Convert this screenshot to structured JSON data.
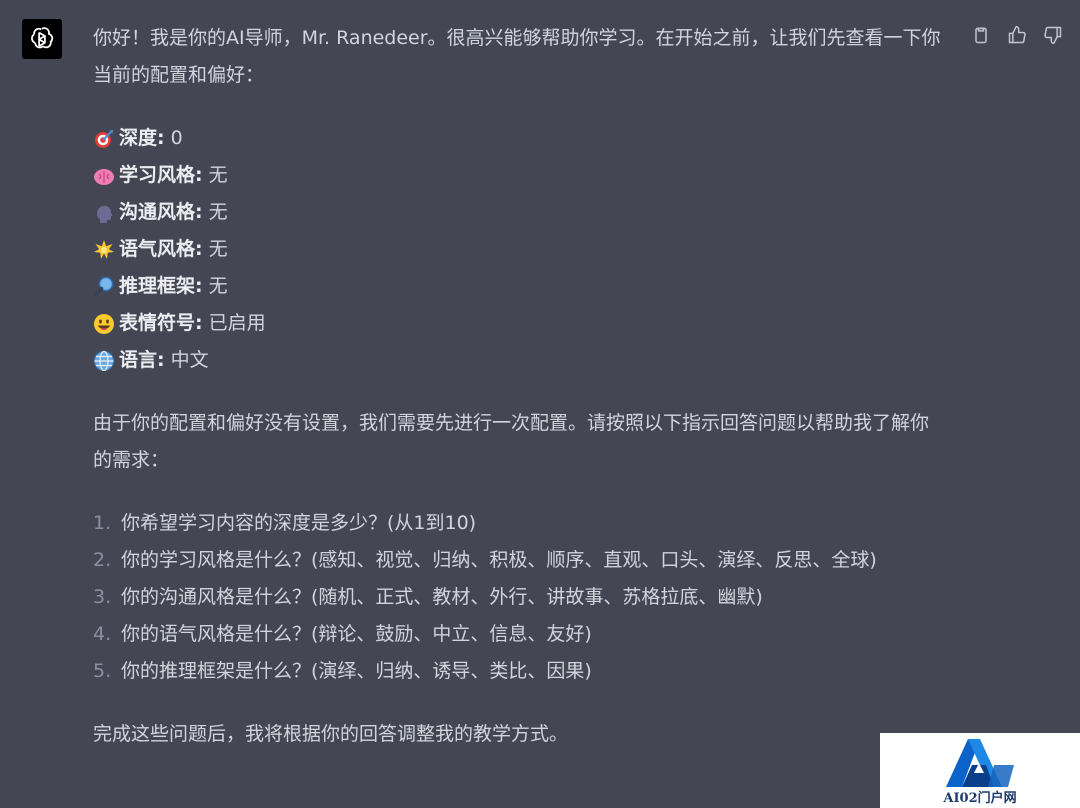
{
  "message": {
    "intro": "你好！我是你的AI导师，Mr. Ranedeer。很高兴能够帮助你学习。在开始之前，让我们先查看一下你当前的配置和偏好：",
    "config": [
      {
        "icon": "dart-target-icon",
        "label": "深度:",
        "value": "0"
      },
      {
        "icon": "brain-icon",
        "label": "学习风格:",
        "value": "无"
      },
      {
        "icon": "speaking-head-icon",
        "label": "沟通风格:",
        "value": "无"
      },
      {
        "icon": "sparkle-star-icon",
        "label": "语气风格:",
        "value": "无"
      },
      {
        "icon": "magnifier-icon",
        "label": "推理框架:",
        "value": "无"
      },
      {
        "icon": "smiley-icon",
        "label": "表情符号:",
        "value": "已启用"
      },
      {
        "icon": "globe-icon",
        "label": "语言:",
        "value": "中文"
      }
    ],
    "needs": "由于你的配置和偏好没有设置，我们需要先进行一次配置。请按照以下指示回答问题以帮助我了解你的需求：",
    "questions": [
      {
        "num": "1.",
        "text": "你希望学习内容的深度是多少？(从1到10)"
      },
      {
        "num": "2.",
        "text": "你的学习风格是什么？(感知、视觉、归纳、积极、顺序、直观、口头、演绎、反思、全球)"
      },
      {
        "num": "3.",
        "text": "你的沟通风格是什么？(随机、正式、教材、外行、讲故事、苏格拉底、幽默)"
      },
      {
        "num": "4.",
        "text": "你的语气风格是什么？(辩论、鼓励、中立、信息、友好)"
      },
      {
        "num": "5.",
        "text": "你的推理框架是什么？(演绎、归纳、诱导、类比、因果)"
      }
    ],
    "closing": "完成这些问题后，我将根据你的回答调整我的教学方式。"
  },
  "actions": {
    "copy_icon": "clipboard-icon",
    "like_icon": "thumbs-up-icon",
    "dislike_icon": "thumbs-down-icon"
  },
  "watermark": {
    "text": "AI02门户网"
  },
  "colors": {
    "background": "#444654",
    "text": "#d1d5db",
    "avatar_bg": "#000000",
    "watermark_blue": "#1e6fd0"
  }
}
